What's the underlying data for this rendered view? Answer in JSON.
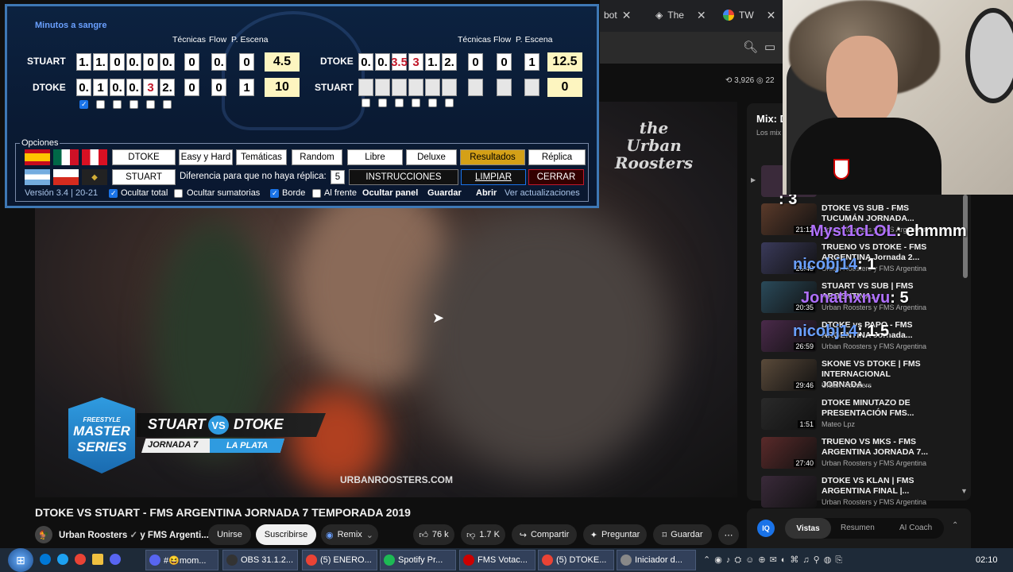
{
  "browser": {
    "tabs": [
      {
        "label": "bot"
      },
      {
        "label": "The"
      },
      {
        "label": "TW"
      }
    ]
  },
  "youtube": {
    "stats": {
      "likes_small": "3,926",
      "views_small": "22"
    },
    "video_title": "DTOKE VS STUART - FMS ARGENTINA JORNADA 7 TEMPORADA 2019",
    "channel": "Urban Roosters",
    "channel_suffix": "y FMS Argenti...",
    "join": "Unirse",
    "subscribe": "Suscribirse",
    "remix": "Remix",
    "likes": "76 k",
    "dislikes": "1.7 K",
    "share": "Compartir",
    "ask": "Preguntar",
    "save": "Guardar",
    "lower_overlay": {
      "red": "STUART",
      "vs": "VS",
      "blue": "DTOKE",
      "jornada": "JORNADA 7",
      "place": "LA PLATA",
      "watermark": "URBANROOSTERS.COM",
      "logo_line1": "FREESTYLE",
      "logo_line2": "MASTER",
      "logo_line3": "SERIES",
      "roosters_logo": "the Urban Roosters"
    },
    "mix_title": "Mix: D",
    "mix_sub": "Los mix",
    "vistas": "Vistas",
    "resumen": "Resumen",
    "coach": "AI Coach",
    "iq": "IQ"
  },
  "sidebar": [
    {
      "title": "DTOKE VS SUB - FMS TUCUMÁN JORNADA...",
      "channel": "Urban Roosters y FMS Argentina",
      "dur": "21:12",
      "color": "#5a3a2a"
    },
    {
      "title": "TRUENO VS DTOKE - FMS ARGENTINA Jornada 2...",
      "channel": "Urban Roosters y FMS Argentina",
      "dur": "26:43",
      "color": "#3a3a5a"
    },
    {
      "title": "STUART VS SUB | FMS ARGENTINA...",
      "channel": "Urban Roosters y FMS Argentina",
      "dur": "20:35",
      "color": "#2a4a5a"
    },
    {
      "title": "DTOKE vs PAPO - FMS ARGENTINA Jornada...",
      "channel": "Urban Roosters y FMS Argentina",
      "dur": "26:59",
      "color": "#4a2a4a"
    },
    {
      "title": "SKONE VS DTOKE | FMS INTERNACIONAL JORNADA ...",
      "channel": "Urban Roosters",
      "dur": "29:46",
      "color": "#5a4a3a"
    },
    {
      "title": "DTOKE MINUTAZO DE PRESENTACIÓN FMS...",
      "channel": "Mateo Lpz",
      "dur": "1:51",
      "color": "#2a2a2a"
    },
    {
      "title": "TRUENO VS MKS - FMS ARGENTINA JORNADA 7...",
      "channel": "Urban Roosters y FMS Argentina",
      "dur": "27:40",
      "color": "#5a2a2a"
    },
    {
      "title": "DTOKE VS KLAN | FMS ARGENTINA FINAL |...",
      "channel": "Urban Roosters y FMS Argentina",
      "dur": "",
      "color": "#3a2a3a"
    }
  ],
  "chat": [
    {
      "user": "Myst1cLOL",
      "msg": ": ehmmm",
      "color": "#b070ff"
    },
    {
      "user": "nicobj14",
      "msg": ": 1",
      "color": "#6aa0ff"
    },
    {
      "user": "Jonathxnvu",
      "msg": ": 5",
      "color": "#b070ff"
    },
    {
      "user": "nicobj14",
      "msg": ": 1.5",
      "color": "#6aa0ff"
    },
    {
      "user": "",
      "msg": ": 3",
      "color": "#ffffff"
    }
  ],
  "panel": {
    "mode": "Minutos a sangre",
    "col_headers": [
      "Técnicas",
      "Flow",
      "P. Escena"
    ],
    "left": {
      "row1": {
        "name": "STUART",
        "cells": [
          "1.",
          "1.",
          "0",
          "0.",
          "0",
          "0.",
          "0",
          "0.",
          "0"
        ],
        "total": "4.5"
      },
      "row2": {
        "name": "DTOKE",
        "cells": [
          "0.",
          "1",
          "0.",
          "0.",
          "3",
          "2.",
          "0",
          "0",
          "1"
        ],
        "total": "10"
      }
    },
    "right": {
      "row1": {
        "name": "DTOKE",
        "cells": [
          "0.",
          "0.",
          "3.5",
          "3",
          "1.",
          "2.",
          "0",
          "0",
          "1"
        ],
        "total": "12.5"
      },
      "row2": {
        "name": "STUART",
        "cells": [
          "",
          "",
          "",
          "",
          "",
          "",
          "",
          "",
          ""
        ],
        "total": "0"
      }
    },
    "options_label": "Opciones",
    "row1_buttons": [
      "DTOKE",
      "Easy y Hard",
      "Temáticas",
      "Random",
      "Libre",
      "Deluxe",
      "Resultados",
      "Réplica"
    ],
    "row2_name": "STUART",
    "diff_label": "Diferencia para que no haya réplica:",
    "diff_value": "5",
    "instrucciones": "INSTRUCCIONES",
    "limpiar": "LIMPIAR",
    "cerrar": "CERRAR",
    "version": "Versión 3.4 | 20-21",
    "ocultar_total": "Ocultar total",
    "ocultar_sum": "Ocultar sumatorias",
    "borde": "Borde",
    "al_frente": "Al frente",
    "ocultar_panel": "Ocultar panel",
    "guardar": "Guardar",
    "abrir": "Abrir",
    "ver_act": "Ver actualizaciones"
  },
  "taskbar": {
    "items": [
      "#😆mom...",
      "OBS 31.1.2...",
      "(5) ENERO...",
      "Spotify Pr...",
      "FMS Votac...",
      "(5) DTOKE...",
      "Iniciador d..."
    ],
    "clock": "02:10"
  }
}
